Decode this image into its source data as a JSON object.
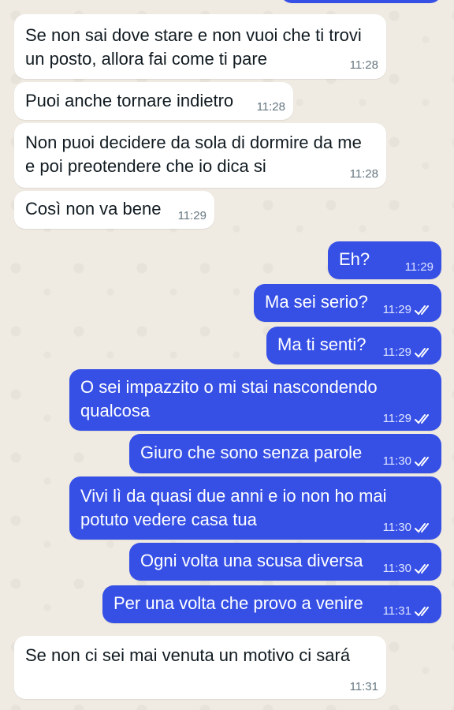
{
  "colors": {
    "wallpaper": "#efeae2",
    "incoming_bubble": "#ffffff",
    "outgoing_bubble": "#3650e6",
    "incoming_text": "#111b21",
    "outgoing_text": "#ffffff",
    "timestamp_in": "#667781",
    "timestamp_out": "#dfe4ff"
  },
  "icons": {
    "read_receipt": "double-check-icon"
  },
  "messages": [
    {
      "dir": "in",
      "lines": [
        "Se non sai dove stare e non vuoi che ti trovi",
        "un posto, allora fai come ti pare"
      ],
      "time": "11:28"
    },
    {
      "dir": "in",
      "lines": [
        "Puoi anche tornare indietro"
      ],
      "time": "11:28"
    },
    {
      "dir": "in",
      "lines": [
        "Non puoi decidere da sola di dormire da me",
        "e poi preotendere che io dica si"
      ],
      "time": "11:28"
    },
    {
      "dir": "in",
      "lines": [
        "Così non va bene"
      ],
      "time": "11:29"
    },
    {
      "dir": "out",
      "lines": [
        "Eh?"
      ],
      "time": "11:29",
      "read": false
    },
    {
      "dir": "out",
      "lines": [
        "Ma sei serio?"
      ],
      "time": "11:29",
      "read": true
    },
    {
      "dir": "out",
      "lines": [
        "Ma ti senti?"
      ],
      "time": "11:29",
      "read": true
    },
    {
      "dir": "out",
      "lines": [
        "O sei impazzito o mi stai nascondendo",
        "qualcosa"
      ],
      "time": "11:29",
      "read": true
    },
    {
      "dir": "out",
      "lines": [
        "Giuro che sono senza parole"
      ],
      "time": "11:30",
      "read": true
    },
    {
      "dir": "out",
      "lines": [
        "Vivi lì da quasi due anni e io non ho mai",
        "potuto vedere casa tua"
      ],
      "time": "11:30",
      "read": true
    },
    {
      "dir": "out",
      "lines": [
        "Ogni volta una scusa diversa"
      ],
      "time": "11:30",
      "read": true
    },
    {
      "dir": "out",
      "lines": [
        "Per una volta che provo a venire"
      ],
      "time": "11:31",
      "read": true
    },
    {
      "dir": "in",
      "lines": [
        "Se non ci sei mai venuta un motivo ci sará"
      ],
      "time": "11:31"
    }
  ]
}
